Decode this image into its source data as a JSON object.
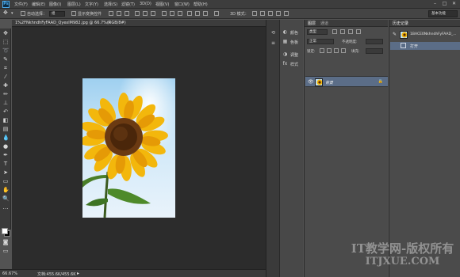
{
  "app": {
    "logo": "Ps"
  },
  "menu": [
    "文件(F)",
    "编辑(E)",
    "图像(I)",
    "图层(L)",
    "文字(Y)",
    "选择(S)",
    "滤镜(T)",
    "3D(D)",
    "视图(V)",
    "窗口(W)",
    "帮助(H)"
  ],
  "window_controls": [
    "–",
    "□",
    "✕"
  ],
  "options_bar": {
    "auto_select_label": "自动选择：",
    "auto_select_value": "组",
    "show_transform_label": "显示变换控件",
    "mode_3d_label": "3D 模式：",
    "workspace": "基本功能"
  },
  "document": {
    "tab_title": "1%2FNkhndhFyFAAD_QyexlM982.jpg @ 66.7%(RGB/8#)",
    "close_glyph": "×"
  },
  "status": {
    "zoom": "66.67%",
    "doc_size": "文档:455.6K/455.6K",
    "arrow": "▸"
  },
  "mini_panel": [
    {
      "icon": "color-icon",
      "glyph": "◐",
      "label": "颜色"
    },
    {
      "icon": "swatches-icon",
      "glyph": "▦",
      "label": "色板"
    },
    {
      "icon": "adjustments-icon",
      "glyph": "◑",
      "label": "调整"
    },
    {
      "icon": "styles-icon",
      "glyph": "fx",
      "label": "样式"
    }
  ],
  "layers_panel": {
    "tabs": [
      "图层",
      "通道"
    ],
    "kind_filter": "类型",
    "blend_mode": "正常",
    "opacity_label": "不透明度:",
    "lock_label": "锁定:",
    "fill_label": "填充:",
    "layer_name": "背景",
    "lock_glyph": "🔒"
  },
  "history_panel": {
    "tab": "历史记录",
    "snapshot_label": "1BACE0NkhndhFyFAAD_...",
    "open_step": "打开"
  },
  "watermark": {
    "line1": "IT教学网-版权所有",
    "line2": "ITJXUE.COM"
  },
  "colors": {
    "accent_selection": "#5b6d87",
    "ps_logo": "#4aa8e8"
  }
}
